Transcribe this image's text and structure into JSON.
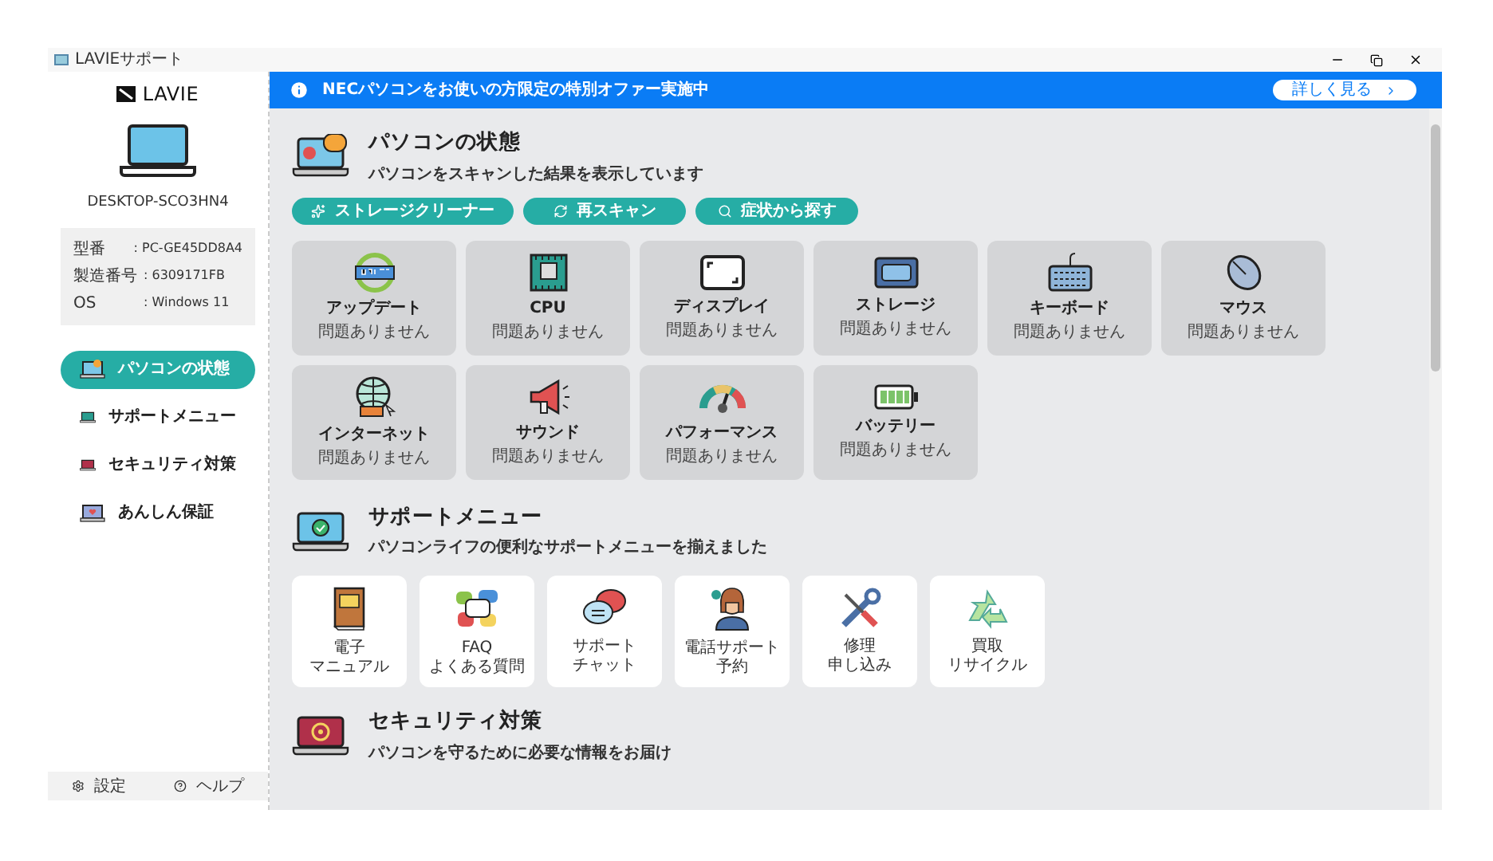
{
  "window": {
    "title": "LAVIEサポート"
  },
  "sidebar": {
    "logo": "LAVIE",
    "device_name": "DESKTOP-SCO3HN4",
    "specs": [
      {
        "label": "型番",
        "value": ": PC-GE45DD8A4"
      },
      {
        "label": "製造番号",
        "value": ": 6309171FB"
      },
      {
        "label": "OS",
        "value": ": Windows 11"
      }
    ],
    "nav": [
      {
        "label": "パソコンの状態",
        "selected": true
      },
      {
        "label": "サポートメニュー",
        "selected": false
      },
      {
        "label": "セキュリティ対策",
        "selected": false
      },
      {
        "label": "あんしん保証",
        "selected": false
      }
    ],
    "footer": [
      "設定",
      "ヘルプ"
    ]
  },
  "banner": {
    "text": "NECパソコンをお使いの方限定の特別オファー実施中",
    "button": "詳しく見る"
  },
  "status_section": {
    "title": "パソコンの状態",
    "subtitle": "パソコンをスキャンした結果を表示しています",
    "actions": [
      "ストレージクリーナー",
      "再スキャン",
      "症状から探す"
    ],
    "items": [
      {
        "name": "アップデート",
        "status": "問題ありません"
      },
      {
        "name": "CPU",
        "status": "問題ありません"
      },
      {
        "name": "ディスプレイ",
        "status": "問題ありません"
      },
      {
        "name": "ストレージ",
        "status": "問題ありません"
      },
      {
        "name": "キーボード",
        "status": "問題ありません"
      },
      {
        "name": "マウス",
        "status": "問題ありません"
      },
      {
        "name": "インターネット",
        "status": "問題ありません"
      },
      {
        "name": "サウンド",
        "status": "問題ありません"
      },
      {
        "name": "パフォーマンス",
        "status": "問題ありません"
      },
      {
        "name": "バッテリー",
        "status": "問題ありません"
      }
    ]
  },
  "support_section": {
    "title": "サポートメニュー",
    "subtitle": "パソコンライフの便利なサポートメニューを揃えました",
    "items": [
      {
        "lines": [
          "電子",
          "マニュアル"
        ]
      },
      {
        "lines": [
          "FAQ",
          "よくある質問"
        ]
      },
      {
        "lines": [
          "サポート",
          "チャット"
        ]
      },
      {
        "lines": [
          "電話サポート",
          "予約"
        ]
      },
      {
        "lines": [
          "修理",
          "申し込み"
        ]
      },
      {
        "lines": [
          "買取",
          "リサイクル"
        ]
      }
    ]
  },
  "security_section": {
    "title": "セキュリティ対策",
    "subtitle": "パソコンを守るために必要な情報をお届け"
  }
}
